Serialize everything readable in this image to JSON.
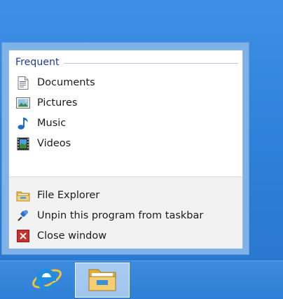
{
  "jumplist": {
    "category": "Frequent",
    "frequent": [
      {
        "label": "Documents",
        "icon": "documents-icon"
      },
      {
        "label": "Pictures",
        "icon": "pictures-icon"
      },
      {
        "label": "Music",
        "icon": "music-icon"
      },
      {
        "label": "Videos",
        "icon": "videos-icon"
      }
    ],
    "tasks": [
      {
        "label": "File Explorer",
        "icon": "folder-icon"
      },
      {
        "label": "Unpin this program from taskbar",
        "icon": "unpin-icon"
      },
      {
        "label": "Close window",
        "icon": "close-icon"
      }
    ]
  },
  "taskbar": {
    "apps": [
      {
        "name": "Internet Explorer",
        "icon": "internet-explorer-icon",
        "active": false
      },
      {
        "name": "File Explorer",
        "icon": "file-explorer-icon",
        "active": true
      }
    ]
  },
  "colors": {
    "accent": "#1a3a9c",
    "desktop": "#2f7fd6",
    "frame": "#7fb2e8"
  }
}
